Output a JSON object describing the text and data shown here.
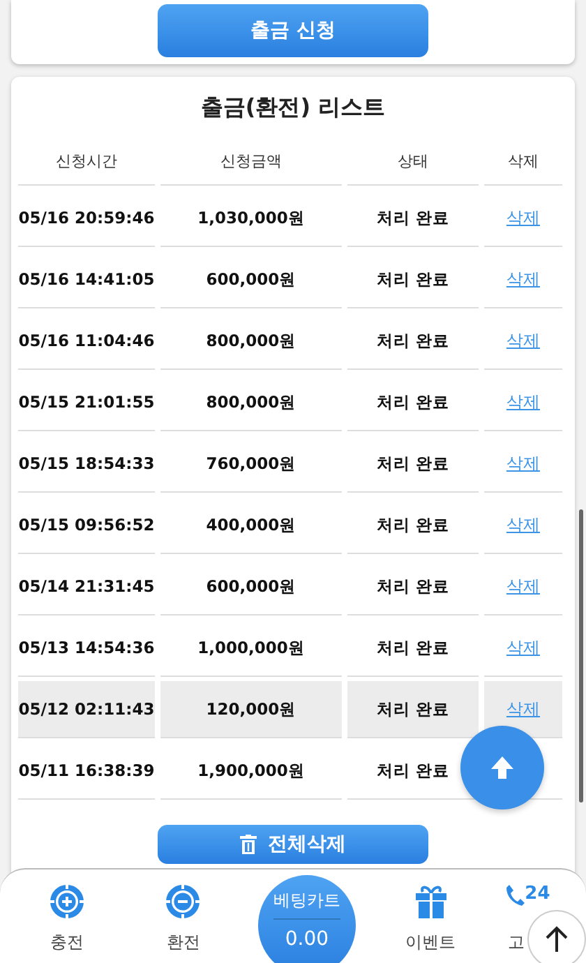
{
  "request_button": "출금 신청",
  "list": {
    "title": "출금(환전) 리스트",
    "columns": [
      "신청시간",
      "신청금액",
      "상태",
      "삭제"
    ],
    "rows": [
      {
        "time": "05/16 20:59:46",
        "amount": "1,030,000원",
        "status": "처리 완료",
        "delete": "삭제",
        "highlighted": false
      },
      {
        "time": "05/16 14:41:05",
        "amount": "600,000원",
        "status": "처리 완료",
        "delete": "삭제",
        "highlighted": false
      },
      {
        "time": "05/16 11:04:46",
        "amount": "800,000원",
        "status": "처리 완료",
        "delete": "삭제",
        "highlighted": false
      },
      {
        "time": "05/15 21:01:55",
        "amount": "800,000원",
        "status": "처리 완료",
        "delete": "삭제",
        "highlighted": false
      },
      {
        "time": "05/15 18:54:33",
        "amount": "760,000원",
        "status": "처리 완료",
        "delete": "삭제",
        "highlighted": false
      },
      {
        "time": "05/15 09:56:52",
        "amount": "400,000원",
        "status": "처리 완료",
        "delete": "삭제",
        "highlighted": false
      },
      {
        "time": "05/14 21:31:45",
        "amount": "600,000원",
        "status": "처리 완료",
        "delete": "삭제",
        "highlighted": false
      },
      {
        "time": "05/13 14:54:36",
        "amount": "1,000,000원",
        "status": "처리 완료",
        "delete": "삭제",
        "highlighted": false
      },
      {
        "time": "05/12 02:11:43",
        "amount": "120,000원",
        "status": "처리 완료",
        "delete": "삭제",
        "highlighted": true
      },
      {
        "time": "05/11 16:38:39",
        "amount": "1,900,000원",
        "status": "처리 완료",
        "highlighted": false
      }
    ],
    "delete_all_button": "전체삭제"
  },
  "bottom_nav": [
    {
      "kind": "charge",
      "label": "충전"
    },
    {
      "kind": "exchange",
      "label": "환전"
    },
    {
      "kind": "betslip",
      "label": "베팅카트",
      "value": "0.00"
    },
    {
      "kind": "event",
      "label": "이벤트"
    },
    {
      "kind": "support",
      "label": "고",
      "badge": "24"
    }
  ]
}
